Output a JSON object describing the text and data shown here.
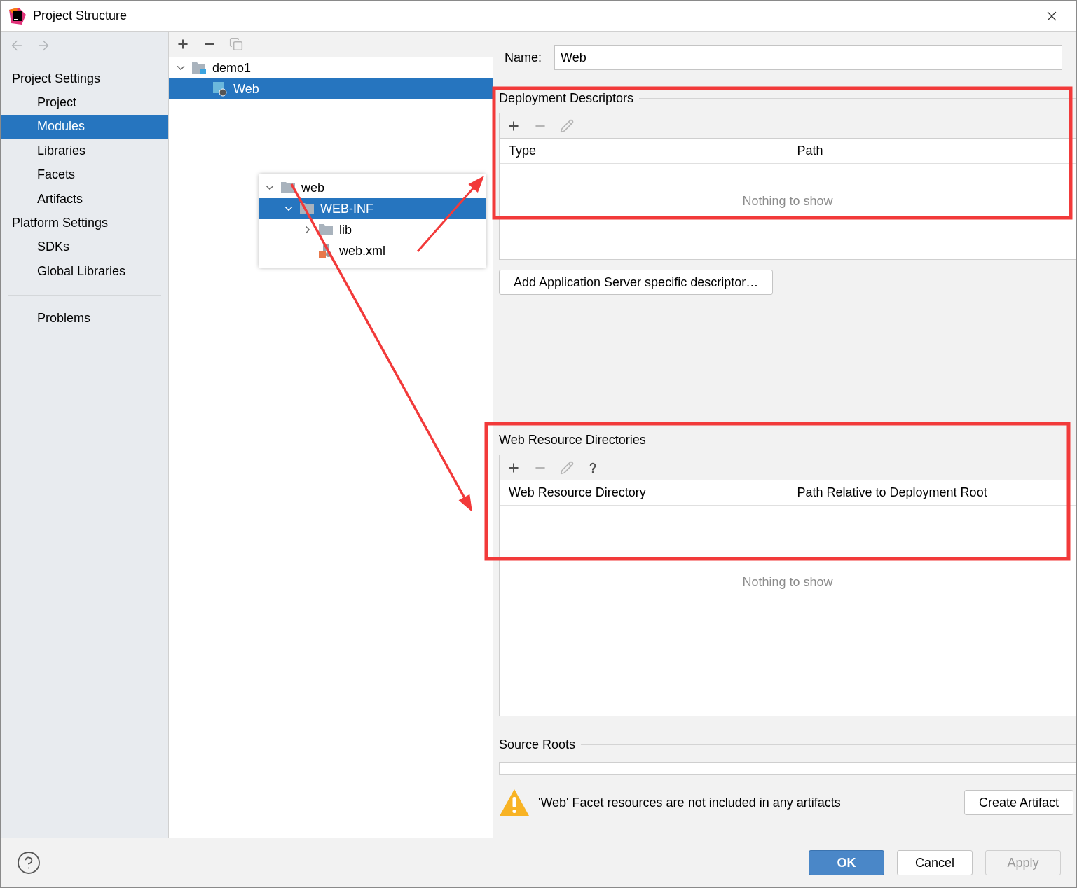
{
  "window": {
    "title": "Project Structure"
  },
  "nav": [
    {
      "kind": "back",
      "disabled": true
    },
    {
      "kind": "forward",
      "disabled": true
    }
  ],
  "sidebar": {
    "sections": [
      {
        "title": "Project Settings",
        "items": [
          {
            "label": "Project",
            "selected": false
          },
          {
            "label": "Modules",
            "selected": true
          },
          {
            "label": "Libraries",
            "selected": false
          },
          {
            "label": "Facets",
            "selected": false
          },
          {
            "label": "Artifacts",
            "selected": false
          }
        ]
      },
      {
        "title": "Platform Settings",
        "items": [
          {
            "label": "SDKs",
            "selected": false
          },
          {
            "label": "Global Libraries",
            "selected": false
          }
        ]
      }
    ],
    "extra_items": [
      {
        "label": "Problems",
        "selected": false
      }
    ]
  },
  "module_toolbar": [
    {
      "kind": "add",
      "disabled": false
    },
    {
      "kind": "remove",
      "disabled": false
    },
    {
      "kind": "copy",
      "disabled": true
    }
  ],
  "module_tree": [
    {
      "label": "demo1",
      "kind": "module",
      "expanded": true,
      "selected": false,
      "children": [
        {
          "label": "Web",
          "kind": "facet",
          "selected": true
        }
      ]
    }
  ],
  "popup_tree": [
    {
      "label": "web",
      "kind": "folder",
      "expanded": true,
      "selected": false,
      "children": [
        {
          "label": "WEB-INF",
          "kind": "folder",
          "expanded": true,
          "selected": true,
          "children": [
            {
              "label": "lib",
              "kind": "folder",
              "expanded": false,
              "selected": false
            },
            {
              "label": "web.xml",
              "kind": "xml",
              "selected": false
            }
          ]
        }
      ]
    }
  ],
  "name_field": {
    "label": "Name:",
    "value": "Web"
  },
  "deployment_descriptors": {
    "title": "Deployment Descriptors",
    "toolbar": [
      {
        "kind": "add",
        "disabled": false
      },
      {
        "kind": "remove",
        "disabled": true
      },
      {
        "kind": "edit",
        "disabled": true
      }
    ],
    "columns": [
      "Type",
      "Path"
    ],
    "empty_text": "Nothing to show",
    "button": {
      "label": "Add Application Server specific descriptor…"
    }
  },
  "web_resource_directories": {
    "title": "Web Resource Directories",
    "toolbar": [
      {
        "kind": "add",
        "disabled": false
      },
      {
        "kind": "remove",
        "disabled": true
      },
      {
        "kind": "edit",
        "disabled": true
      },
      {
        "kind": "help",
        "disabled": false
      }
    ],
    "columns": [
      "Web Resource Directory",
      "Path Relative to Deployment Root"
    ],
    "empty_text": "Nothing to show"
  },
  "source_roots": {
    "title": "Source Roots"
  },
  "warning": {
    "text": "'Web' Facet resources are not included in any artifacts",
    "button": {
      "label": "Create Artifact"
    }
  },
  "footer": {
    "buttons": [
      {
        "label": "OK",
        "default": true,
        "disabled": false
      },
      {
        "label": "Cancel",
        "default": false,
        "disabled": false
      },
      {
        "label": "Apply",
        "default": false,
        "disabled": true
      }
    ]
  },
  "annotations": [
    {
      "kind": "box"
    },
    {
      "kind": "box"
    },
    {
      "kind": "arrow"
    },
    {
      "kind": "arrow"
    }
  ]
}
